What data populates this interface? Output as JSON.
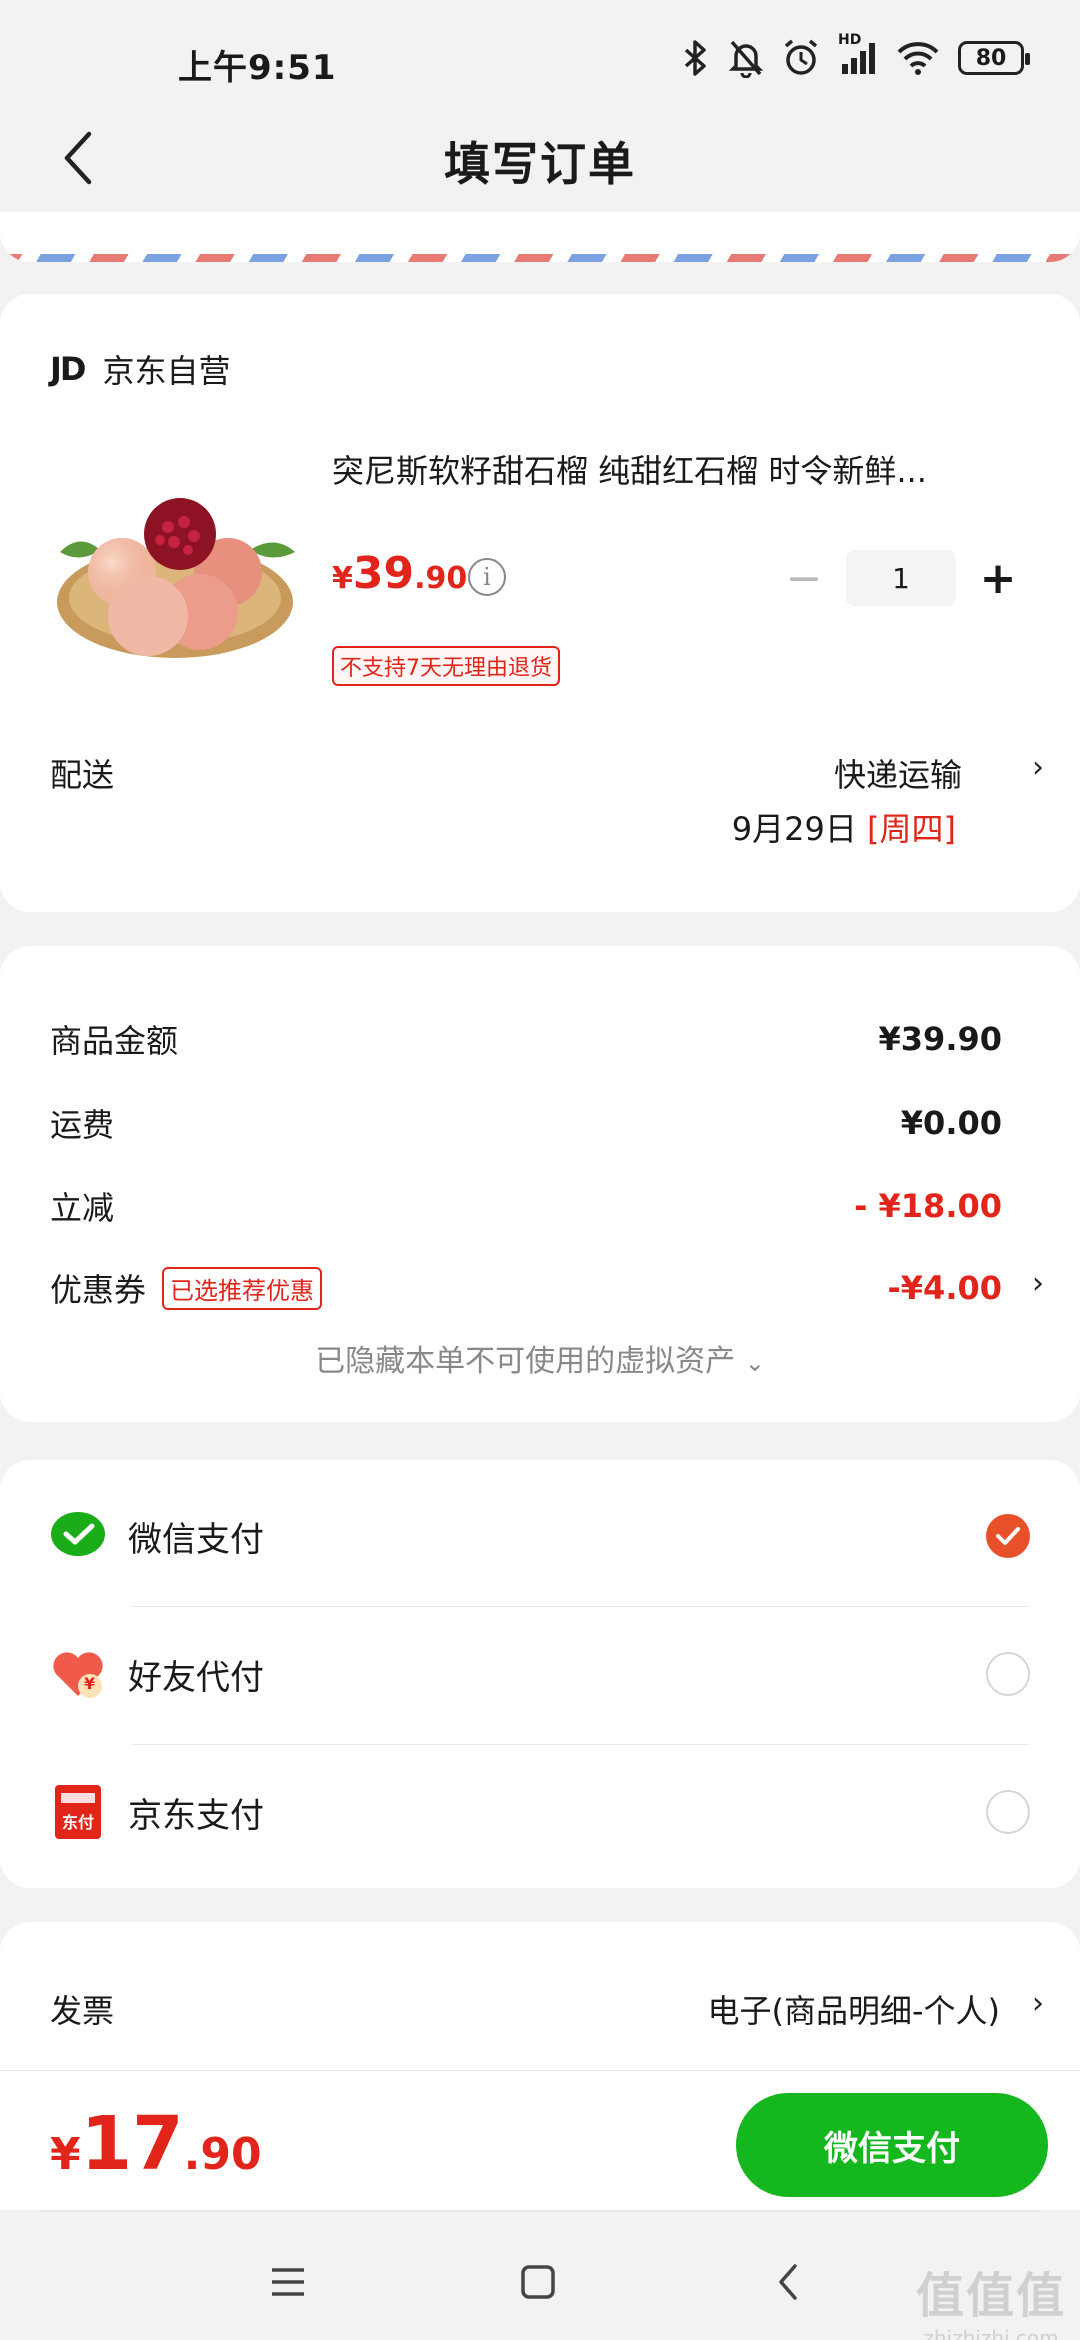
{
  "status_bar": {
    "time": "上午9:51",
    "battery": "80",
    "network_label": "HD"
  },
  "header": {
    "title": "填写订单"
  },
  "shop": {
    "logo": "JD",
    "name": "京东自营",
    "product": {
      "title": "突尼斯软籽甜石榴 纯甜红石榴 时令新鲜...",
      "price_currency": "¥",
      "price_int": "39",
      "price_dec": ".90",
      "quantity": "1",
      "minus_label": "−",
      "plus_label": "+",
      "return_tag": "不支持7天无理由退货"
    },
    "delivery": {
      "label": "配送",
      "method": "快递运输",
      "date": "9月29日",
      "weekday": "[周四]"
    }
  },
  "amounts": {
    "rows": [
      {
        "label": "商品金额",
        "value": "¥39.90"
      },
      {
        "label": "运费",
        "value": "¥0.00"
      },
      {
        "label": "立减",
        "value": "- ¥18.00"
      },
      {
        "label": "优惠券",
        "value": "-¥4.00",
        "tag": "已选推荐优惠"
      }
    ],
    "hidden_note": "已隐藏本单不可使用的虚拟资产"
  },
  "payment": {
    "methods": [
      {
        "label": "微信支付",
        "selected": true,
        "icon": "wechat-pay-icon"
      },
      {
        "label": "好友代付",
        "selected": false,
        "icon": "friend-pay-icon"
      },
      {
        "label": "京东支付",
        "selected": false,
        "icon": "jd-pay-icon"
      }
    ],
    "jd_pay_icon_text": "东付",
    "friend_pay_icon_text": "¥"
  },
  "invoice": {
    "label": "发票",
    "value": "电子(商品明细-个人)"
  },
  "footer": {
    "total_currency": "¥",
    "total_int": "17",
    "total_dec": ".90",
    "pay_button": "微信支付"
  },
  "watermark": {
    "logo": "值值值",
    "url": "zhizhizhi.com"
  },
  "colors": {
    "accent_red": "#e1251b",
    "wechat_green": "#14b81e",
    "radio_checked": "#e8502a"
  }
}
